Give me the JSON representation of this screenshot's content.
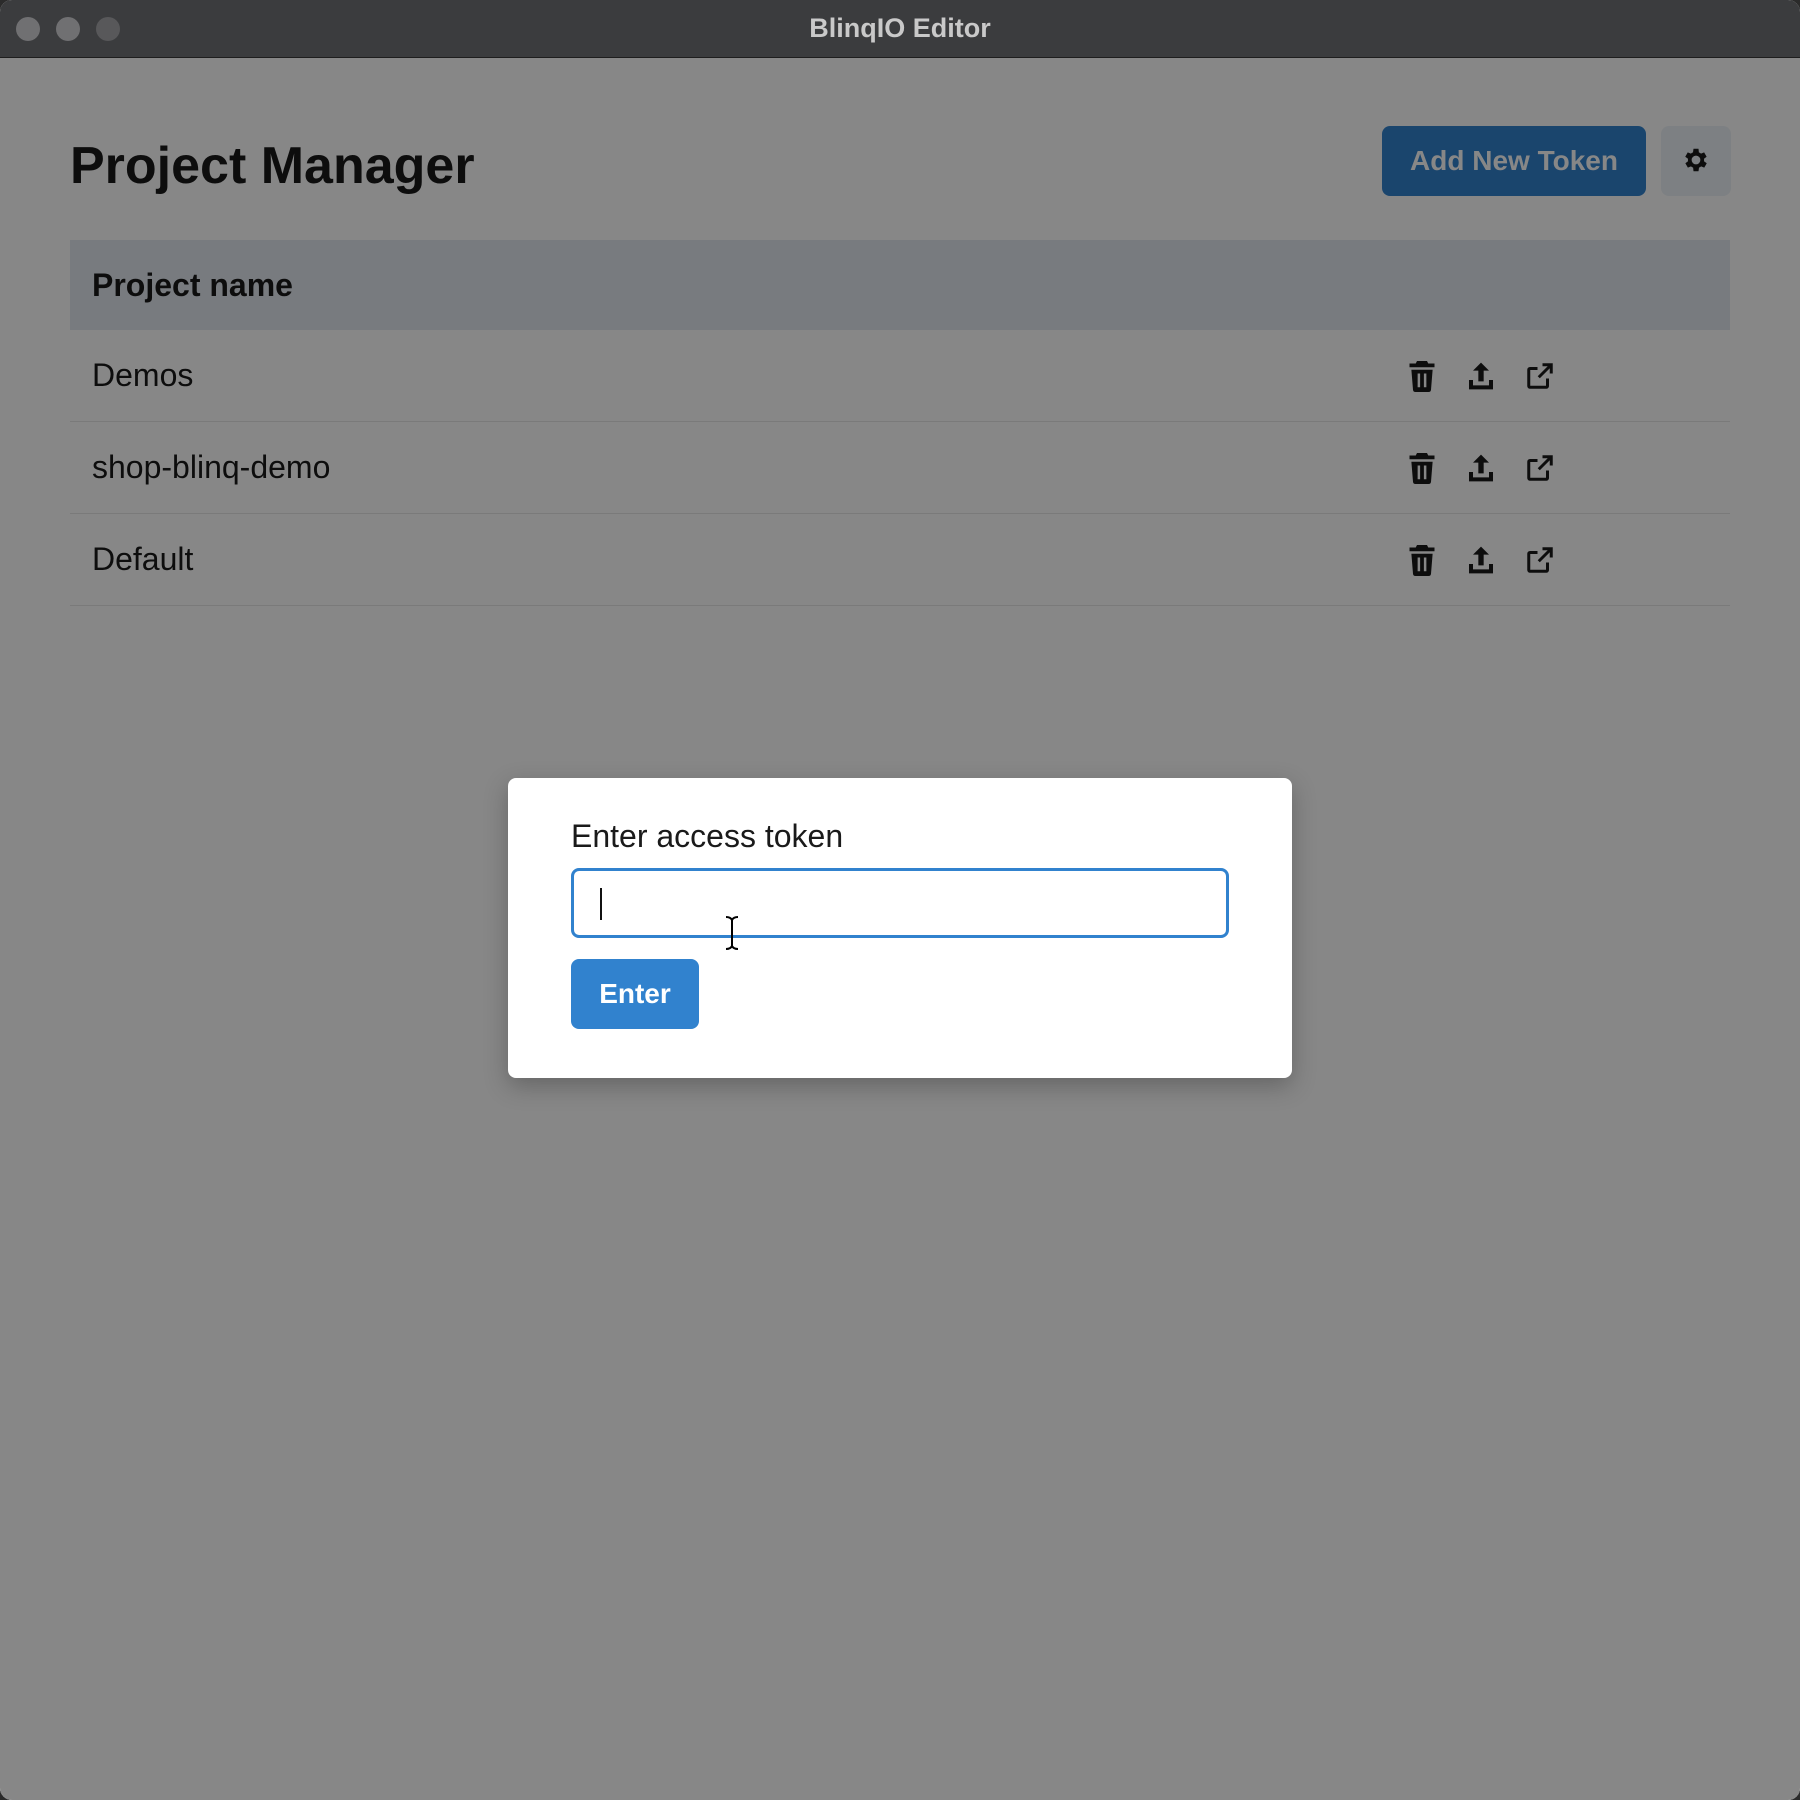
{
  "window": {
    "title": "BlinqIO Editor"
  },
  "header": {
    "page_title": "Project Manager",
    "add_token_label": "Add New Token",
    "settings_icon": "gear-icon"
  },
  "table": {
    "column_header": "Project name",
    "rows": [
      {
        "name": "Demos"
      },
      {
        "name": "shop-blinq-demo"
      },
      {
        "name": "Default"
      }
    ],
    "row_actions": [
      "trash-icon",
      "upload-icon",
      "external-link-icon"
    ]
  },
  "modal": {
    "label": "Enter access token",
    "input_value": "",
    "submit_label": "Enter"
  },
  "colors": {
    "accent": "#3182ce",
    "titlebar": "#3b3c3e",
    "table_header": "#e2e8f0"
  }
}
